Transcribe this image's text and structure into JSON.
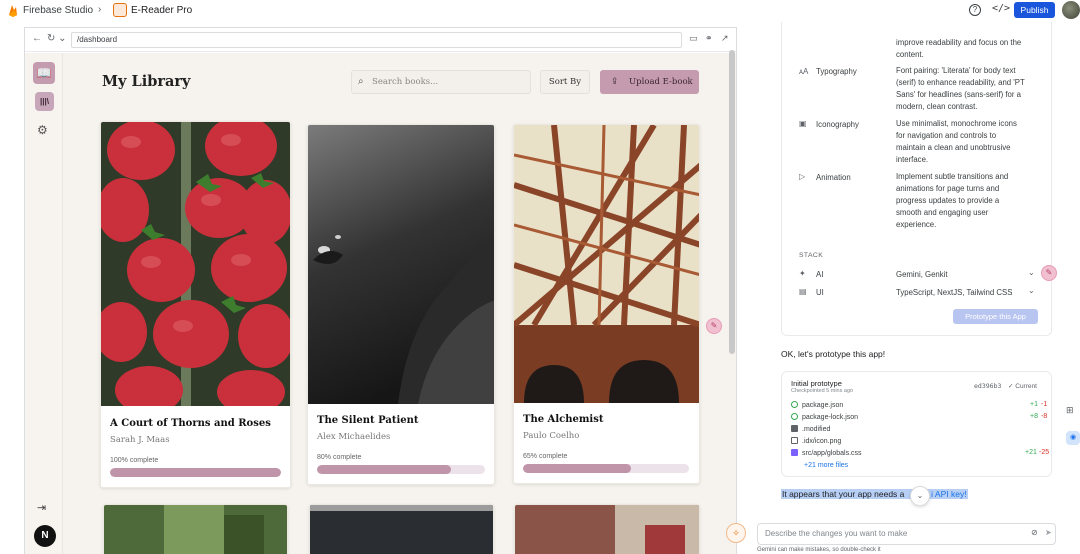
{
  "topbar": {
    "studio_name": "Firebase Studio",
    "breadcrumb_sep": "›",
    "app_name": "E-Reader Pro",
    "help_icon": "?",
    "code_icon": "</>",
    "publish_label": "Publish"
  },
  "browser": {
    "back": "←",
    "reload": "↻ ⌄",
    "url": "/dashboard"
  },
  "app": {
    "rail": {
      "reader_icon": "📖",
      "library_icon": "|||\\",
      "settings_icon": "⚙",
      "logout_icon": "⇥",
      "user_initial": "N"
    },
    "title": "My Library",
    "search_placeholder": "Search books...",
    "sort_label": "Sort By",
    "upload_label": "Upload E-book",
    "books": [
      {
        "title": "A Court of Thorns and Roses",
        "author": "Sarah J. Maas",
        "progress_text": "100% complete",
        "progress": 1.0
      },
      {
        "title": "The Silent Patient",
        "author": "Alex Michaelides",
        "progress_text": "80% complete",
        "progress": 0.8
      },
      {
        "title": "The Alchemist",
        "author": "Paulo Coelho",
        "progress_text": "65% complete",
        "progress": 0.65
      }
    ]
  },
  "chat": {
    "blueprint": {
      "intro_lines": [
        "improve readability and focus on the",
        "content."
      ],
      "typography_label": "Typography",
      "typography_lines": [
        "Font pairing: 'Literata' for body text",
        "(serif) to enhance readability, and 'PT",
        "Sans' for headlines (sans-serif) for a",
        "modern, clean contrast."
      ],
      "iconography_label": "Iconography",
      "iconography_lines": [
        "Use minimalist, monochrome icons",
        "for navigation and controls to",
        "maintain a clean and unobtrusive",
        "interface."
      ],
      "animation_label": "Animation",
      "animation_lines": [
        "Implement subtle transitions and",
        "animations for page turns and",
        "progress updates to provide a",
        "smooth and engaging user",
        "experience."
      ],
      "stack_heading": "STACK",
      "ai_label": "AI",
      "ai_value": "Gemini, Genkit",
      "ui_label": "UI",
      "ui_value": "TypeScript, NextJS, Tailwind CSS",
      "prototype_button": "Prototype this App"
    },
    "ok_message": "OK, let's prototype this app!",
    "checkpoint": {
      "title": "Initial prototype",
      "subtitle": "Checkpointed 5 mins ago",
      "hash": "ed396b3",
      "current_label": "✓ Current",
      "files": [
        {
          "name": "package.json",
          "add": "+1",
          "del": "-1"
        },
        {
          "name": "package-lock.json",
          "add": "+8",
          "del": "-8"
        },
        {
          "name": ".modified",
          "add": "",
          "del": ""
        },
        {
          "name": ".idx/icon.png",
          "add": "",
          "del": ""
        },
        {
          "name": "src/app/globals.css",
          "add": "+21",
          "del": "-25"
        }
      ],
      "more_files": "+21 more files"
    },
    "selected_message_a": "It appears that your app needs a",
    "selected_message_b": "i API key!",
    "input_placeholder": "Describe the changes you want to make",
    "disclaimer": "Gemini can make mistakes, so double-check it"
  },
  "colors": {
    "accent": "#c59bb0",
    "publish": "#1a56db",
    "progress_fill": "#c095aa"
  }
}
